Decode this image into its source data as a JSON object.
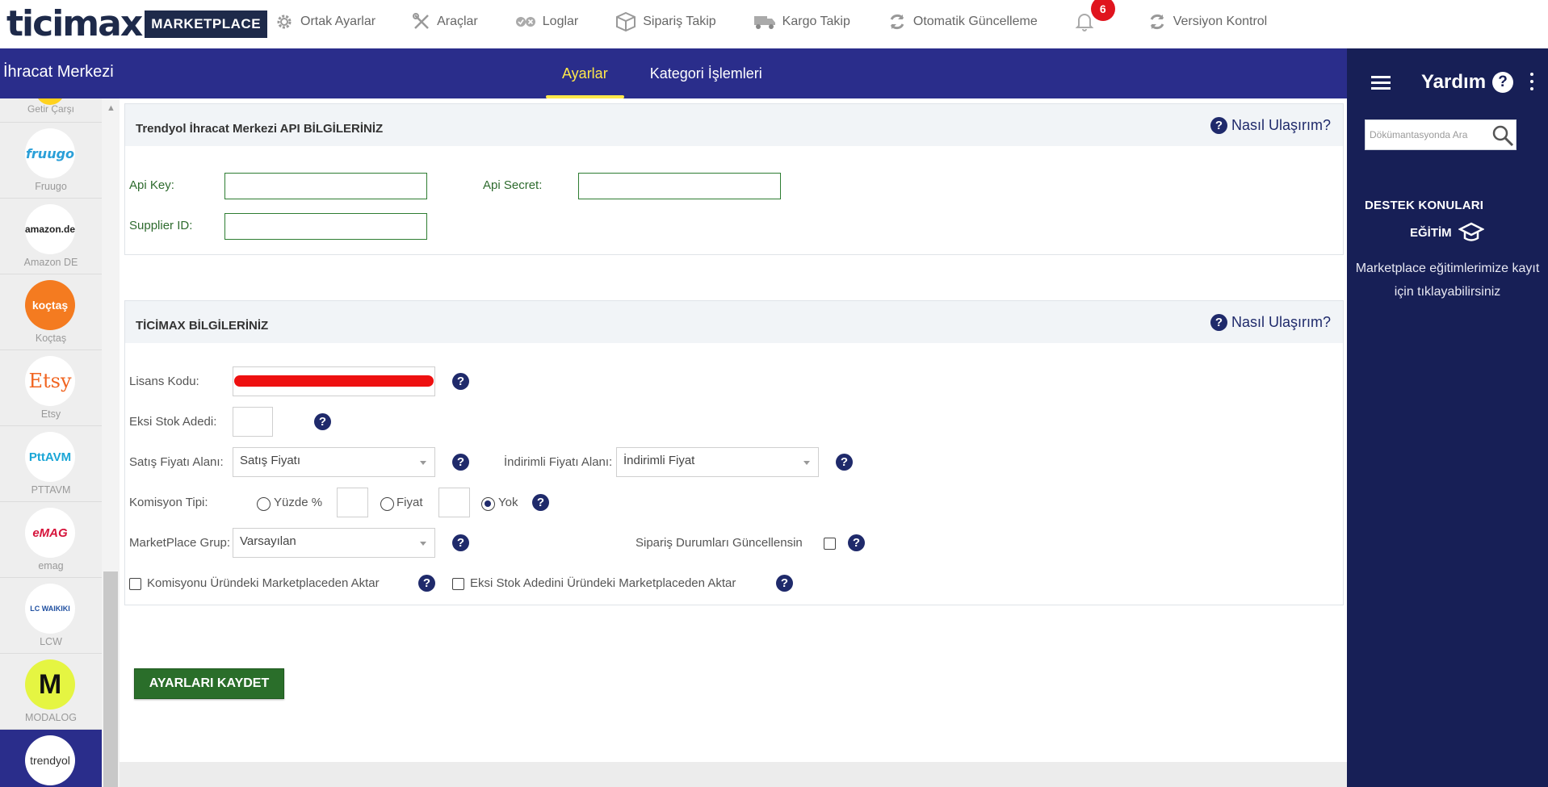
{
  "topbar": {
    "logo_word": "ticimax",
    "logo_badge": "MARKETPLACE",
    "nav": [
      {
        "label": "Ortak Ayarlar",
        "icon": "gear-icon"
      },
      {
        "label": "Araçlar",
        "icon": "tools-icon"
      },
      {
        "label": "Loglar",
        "icon": "log-icon"
      },
      {
        "label": "Sipariş Takip",
        "icon": "box-icon"
      },
      {
        "label": "Kargo Takip",
        "icon": "truck-icon"
      },
      {
        "label": "Otomatik Güncelleme",
        "icon": "refresh-icon"
      }
    ],
    "notifications_count": "6",
    "version_label": "Versiyon Kontrol"
  },
  "header": {
    "title": "İhracat Merkezi",
    "tabs": [
      {
        "label": "Ayarlar",
        "active": true
      },
      {
        "label": "Kategori İşlemleri",
        "active": false
      }
    ]
  },
  "sidebar": {
    "first_label": "Getir Çarşı",
    "items": [
      {
        "label": "Fruugo",
        "logo_text": "fruugo",
        "logo_color": "#2a9fd8"
      },
      {
        "label": "Amazon DE",
        "logo_text": "amazon.de",
        "logo_color": "#222222"
      },
      {
        "label": "Koçtaş",
        "logo_text": "koçtaş",
        "logo_color": "#ffffff"
      },
      {
        "label": "Etsy",
        "logo_text": "Etsy",
        "logo_color": "#f16521"
      },
      {
        "label": "PTTAVM",
        "logo_text": "PttAVM",
        "logo_color": "#1aa6d6"
      },
      {
        "label": "emag",
        "logo_text": "eMAG",
        "logo_color": "#d6143b"
      },
      {
        "label": "LCW",
        "logo_text": "LC WAIKIKI",
        "logo_color": "#1f4fa0"
      },
      {
        "label": "MODALOG",
        "logo_text": "M",
        "logo_color": "#111111"
      },
      {
        "label": "",
        "logo_text": "trendyol",
        "logo_color": "#333333"
      }
    ]
  },
  "api_panel": {
    "title": "Trendyol İhracat Merkezi API BİLGİLERİNİZ",
    "help_link": "Nasıl Ulaşırım?",
    "api_key_label": "Api Key:",
    "api_key_value": "",
    "api_secret_label": "Api Secret:",
    "api_secret_value": "",
    "supplier_id_label": "Supplier ID:",
    "supplier_id_value": ""
  },
  "ticimax_panel": {
    "title": "TİCİMAX BİLGİLERİNİZ",
    "help_link": "Nasıl Ulaşırım?",
    "license_label": "Lisans Kodu:",
    "negative_stock_label": "Eksi Stok Adedi:",
    "negative_stock_value": "",
    "sale_price_label": "Satış Fiyatı Alanı:",
    "sale_price_value": "Satış Fiyatı",
    "discount_price_label": "İndirimli Fiyatı Alanı:",
    "discount_price_value": "İndirimli Fiyat",
    "commission_label": "Komisyon Tipi:",
    "commission_options": [
      "Yüzde %",
      "Fiyat",
      "Yok"
    ],
    "commission_selected": "Yok",
    "commission_percent_value": "",
    "commission_price_value": "",
    "group_label": "MarketPlace Grup:",
    "group_value": "Varsayılan",
    "order_status_label": "Sipariş Durumları Güncellensin",
    "order_status_checked": false,
    "transfer_commission_label": "Komisyonu Üründeki Marketplaceden Aktar",
    "transfer_commission_checked": false,
    "transfer_stock_label": "Eksi Stok Adedini Üründeki Marketplaceden Aktar",
    "transfer_stock_checked": false
  },
  "save_button": "AYARLARI KAYDET",
  "help_panel": {
    "title": "Yardım",
    "search_placeholder": "Dökümantasyonda Ara",
    "support_heading": "DESTEK KONULARI",
    "training_label": "EĞİTİM",
    "training_text": "Marketplace eğitimlerimize kayıt için tıklayabilirsiniz"
  },
  "colors": {
    "header_bg": "#2a2d8b",
    "active_tab": "#ffe84a",
    "help_panel_bg": "#171f56",
    "save_button_bg": "#2a6e2a",
    "notification_badge": "#e0141e"
  }
}
